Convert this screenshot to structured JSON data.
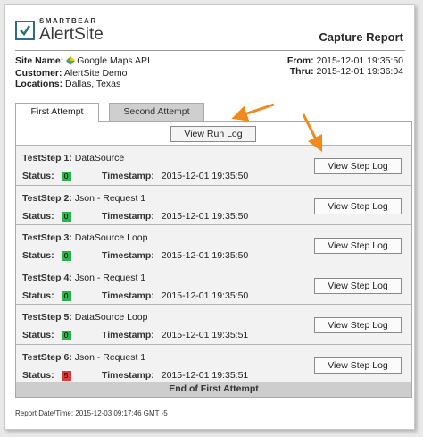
{
  "header": {
    "brand": "SMARTBEAR",
    "product": "AlertSite",
    "report_title": "Capture Report"
  },
  "info": {
    "site_name_label": "Site Name:",
    "site_name": "Google Maps API",
    "customer_label": "Customer:",
    "customer": "AlertSite Demo",
    "locations_label": "Locations:",
    "locations": "Dallas, Texas",
    "from_label": "From:",
    "from": "2015-12-01 19:35:50",
    "thru_label": "Thru:",
    "thru": "2015-12-01 19:36:04"
  },
  "tabs": [
    {
      "label": "First Attempt",
      "active": true
    },
    {
      "label": "Second Attempt",
      "active": false
    }
  ],
  "view_run_log_label": "View Run Log",
  "status_label": "Status:",
  "timestamp_label": "Timestamp:",
  "steps": [
    {
      "label": "TestStep 1:",
      "name": "DataSource",
      "status": "0",
      "timestamp": "2015-12-01 19:35:50",
      "button": "View Step Log"
    },
    {
      "label": "TestStep 2:",
      "name": "Json - Request 1",
      "status": "0",
      "timestamp": "2015-12-01 19:35:50",
      "button": "View Step Log"
    },
    {
      "label": "TestStep 3:",
      "name": "DataSource Loop",
      "status": "0",
      "timestamp": "2015-12-01 19:35:50",
      "button": "View Step Log"
    },
    {
      "label": "TestStep 4:",
      "name": "Json - Request 1",
      "status": "0",
      "timestamp": "2015-12-01 19:35:50",
      "button": "View Step Log"
    },
    {
      "label": "TestStep 5:",
      "name": "DataSource Loop",
      "status": "0",
      "timestamp": "2015-12-01 19:35:51",
      "button": "View Step Log"
    },
    {
      "label": "TestStep 6:",
      "name": "Json - Request 1",
      "status": "5",
      "timestamp": "2015-12-01 19:35:51",
      "button": "View Step Log"
    }
  ],
  "end_label": "End of First Attempt",
  "report_date": "Report Date/Time: 2015-12-03 09:17:46 GMT -5",
  "colors": {
    "status_ok": "#2bb24c",
    "status_error": "#e03a3a",
    "annotation_arrow": "#f08a1c",
    "logo": "#2b6f86"
  }
}
